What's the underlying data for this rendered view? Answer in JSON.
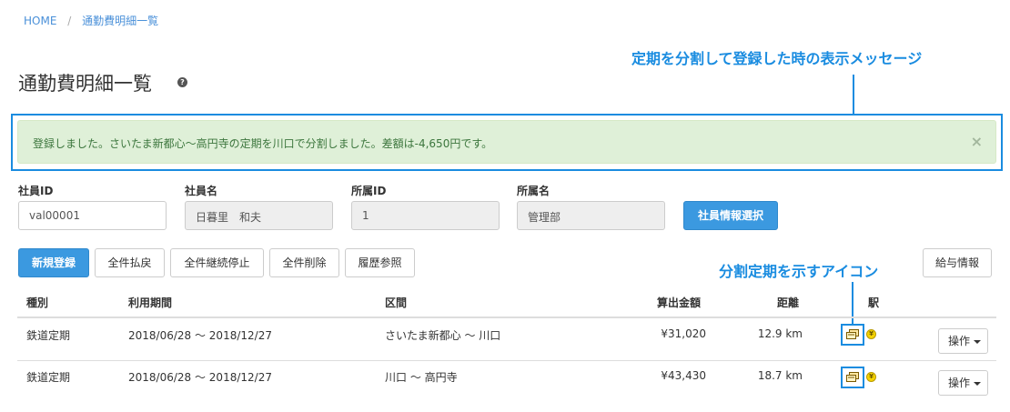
{
  "breadcrumb": {
    "home": "HOME",
    "separator": "/",
    "current": "通勤費明細一覧"
  },
  "page": {
    "title": "通勤費明細一覧",
    "help_glyph": "?"
  },
  "annotations": {
    "message_note": "定期を分割して登録した時の表示メッセージ",
    "icon_note": "分割定期を示すアイコン",
    "color": "#1a8ce0"
  },
  "alert": {
    "message": "登録しました。さいたま新都心〜高円寺の定期を川口で分割しました。差額は-4,650円です。",
    "close": "×"
  },
  "employee": {
    "id_label": "社員ID",
    "id_value": "val00001",
    "name_label": "社員名",
    "name_value": "日暮里　和夫",
    "dept_id_label": "所属ID",
    "dept_id_value": "1",
    "dept_name_label": "所属名",
    "dept_name_value": "管理部",
    "select_button": "社員情報選択"
  },
  "toolbar": {
    "new": "新規登録",
    "refund_all": "全件払戻",
    "stop_all": "全件継続停止",
    "delete_all": "全件削除",
    "history": "履歴参照",
    "salary": "給与情報"
  },
  "table": {
    "headers": {
      "type": "種別",
      "period": "利用期間",
      "section": "区間",
      "amount": "算出金額",
      "distance": "距離",
      "station": "駅"
    },
    "rows": [
      {
        "type": "鉄道定期",
        "period": "2018/06/28 〜 2018/12/27",
        "section": "さいたま新都心 〜 川口",
        "amount": "¥31,020",
        "distance": "12.9 km",
        "split_icon": "split-pass-icon",
        "yen_icon": "yen-icon",
        "action": "操作"
      },
      {
        "type": "鉄道定期",
        "period": "2018/06/28 〜 2018/12/27",
        "section": "川口 〜 高円寺",
        "amount": "¥43,430",
        "distance": "18.7 km",
        "split_icon": "split-pass-icon",
        "yen_icon": "yen-icon",
        "action": "操作"
      }
    ]
  },
  "colors": {
    "primary": "#3b99e0",
    "alert_bg": "#dff0d8",
    "alert_text": "#3c763d",
    "link": "#4a90d9"
  }
}
